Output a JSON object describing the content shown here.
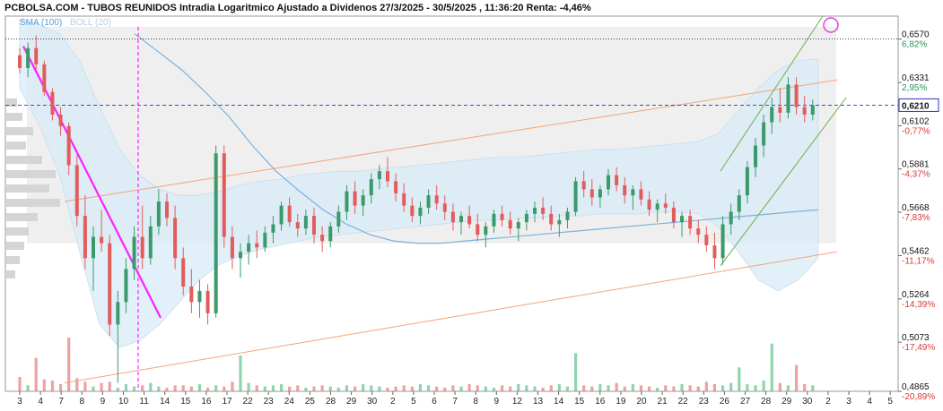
{
  "chart_data": {
    "type": "candlestick",
    "title": "PCBOLSA.COM - TUBOS REUNIDOS Intradia Logaritmico Ajustado a Dividenos 27/3/2025 - 30/5/2025 , 11:36:20 Renta: -4,46%",
    "legend": {
      "sma": "SMA (100)",
      "boll": "BOLL (20)"
    },
    "scale": "log",
    "ylim": [
      0.4865,
      0.67
    ],
    "price_ticks": [
      {
        "price": 0.657,
        "pct": "6,82%",
        "pos": true
      },
      {
        "price": 0.6331,
        "pct": "2,95%",
        "pos": true
      },
      {
        "price": 0.6102,
        "pct": "-0,77%",
        "pos": false
      },
      {
        "price": 0.5881,
        "pct": "-4,37%",
        "pos": false
      },
      {
        "price": 0.5668,
        "pct": "-7,83%",
        "pos": false
      },
      {
        "price": 0.5462,
        "pct": "-11,17%",
        "pos": false
      },
      {
        "price": 0.5264,
        "pct": "-14,39%",
        "pos": false
      },
      {
        "price": 0.5073,
        "pct": "-17,49%",
        "pos": false
      },
      {
        "price": 0.4865,
        "pct": "-20,89%",
        "pos": false
      }
    ],
    "price_tick_labels": [
      "0,6570",
      "0,6331",
      "0,6102",
      "0,5881",
      "0,5668",
      "0,5462",
      "0,5264",
      "0,5073",
      "0,4865"
    ],
    "current_price": {
      "value": 0.621,
      "label": "0,6210"
    },
    "reference_price": 0.657,
    "date_labels": [
      "3",
      "4",
      "7",
      "8",
      "9",
      "10",
      "11",
      "14",
      "15",
      "16",
      "17",
      "22",
      "23",
      "24",
      "25",
      "28",
      "29",
      "30",
      "2",
      "5",
      "6",
      "7",
      "8",
      "9",
      "12",
      "13",
      "14",
      "15",
      "16",
      "19",
      "20",
      "21",
      "22",
      "23",
      "26",
      "27",
      "28",
      "29",
      "30",
      "2",
      "3",
      "4",
      "5"
    ],
    "last_data_index": 38,
    "candles": [
      [
        0.648,
        0.652,
        0.638,
        0.641
      ],
      [
        0.641,
        0.655,
        0.636,
        0.652
      ],
      [
        0.652,
        0.659,
        0.64,
        0.643
      ],
      [
        0.643,
        0.645,
        0.626,
        0.628
      ],
      [
        0.628,
        0.63,
        0.613,
        0.616
      ],
      [
        0.616,
        0.62,
        0.605,
        0.61
      ],
      [
        0.61,
        0.612,
        0.585,
        0.59
      ],
      [
        0.59,
        0.595,
        0.56,
        0.565
      ],
      [
        0.565,
        0.575,
        0.54,
        0.545
      ],
      [
        0.545,
        0.56,
        0.53,
        0.555
      ],
      [
        0.555,
        0.568,
        0.548,
        0.552
      ],
      [
        0.552,
        0.556,
        0.51,
        0.515
      ],
      [
        0.515,
        0.53,
        0.49,
        0.525
      ],
      [
        0.525,
        0.545,
        0.52,
        0.54
      ],
      [
        0.54,
        0.56,
        0.535,
        0.555
      ],
      [
        0.555,
        0.57,
        0.54,
        0.545
      ],
      [
        0.545,
        0.565,
        0.542,
        0.56
      ],
      [
        0.56,
        0.578,
        0.556,
        0.572
      ],
      [
        0.572,
        0.576,
        0.56,
        0.564
      ],
      [
        0.564,
        0.57,
        0.54,
        0.545
      ],
      [
        0.545,
        0.55,
        0.528,
        0.532
      ],
      [
        0.532,
        0.54,
        0.52,
        0.525
      ],
      [
        0.525,
        0.535,
        0.518,
        0.53
      ],
      [
        0.53,
        0.533,
        0.515,
        0.52
      ],
      [
        0.52,
        0.6,
        0.518,
        0.596
      ],
      [
        0.596,
        0.6,
        0.55,
        0.555
      ],
      [
        0.555,
        0.56,
        0.54,
        0.545
      ],
      [
        0.545,
        0.552,
        0.536,
        0.548
      ],
      [
        0.548,
        0.556,
        0.542,
        0.552
      ],
      [
        0.552,
        0.558,
        0.545,
        0.55
      ],
      [
        0.55,
        0.56,
        0.548,
        0.557
      ],
      [
        0.557,
        0.565,
        0.552,
        0.561
      ],
      [
        0.561,
        0.572,
        0.558,
        0.57
      ],
      [
        0.57,
        0.574,
        0.56,
        0.562
      ],
      [
        0.562,
        0.566,
        0.555,
        0.559
      ],
      [
        0.559,
        0.568,
        0.556,
        0.565
      ],
      [
        0.565,
        0.569,
        0.552,
        0.556
      ],
      [
        0.556,
        0.56,
        0.548,
        0.553
      ],
      [
        0.553,
        0.562,
        0.55,
        0.56
      ],
      [
        0.56,
        0.57,
        0.557,
        0.567
      ],
      [
        0.567,
        0.58,
        0.563,
        0.577
      ],
      [
        0.577,
        0.582,
        0.566,
        0.57
      ],
      [
        0.57,
        0.578,
        0.565,
        0.575
      ],
      [
        0.575,
        0.586,
        0.571,
        0.583
      ],
      [
        0.583,
        0.59,
        0.578,
        0.587
      ],
      [
        0.587,
        0.594,
        0.579,
        0.582
      ],
      [
        0.582,
        0.586,
        0.572,
        0.576
      ],
      [
        0.576,
        0.581,
        0.567,
        0.57
      ],
      [
        0.57,
        0.574,
        0.562,
        0.565
      ],
      [
        0.565,
        0.572,
        0.561,
        0.569
      ],
      [
        0.569,
        0.578,
        0.566,
        0.575
      ],
      [
        0.575,
        0.58,
        0.568,
        0.571
      ],
      [
        0.571,
        0.575,
        0.563,
        0.567
      ],
      [
        0.567,
        0.571,
        0.558,
        0.562
      ],
      [
        0.562,
        0.567,
        0.556,
        0.565
      ],
      [
        0.565,
        0.57,
        0.559,
        0.561
      ],
      [
        0.561,
        0.566,
        0.553,
        0.556
      ],
      [
        0.556,
        0.562,
        0.55,
        0.56
      ],
      [
        0.56,
        0.568,
        0.557,
        0.566
      ],
      [
        0.566,
        0.57,
        0.56,
        0.563
      ],
      [
        0.563,
        0.567,
        0.556,
        0.559
      ],
      [
        0.559,
        0.564,
        0.553,
        0.562
      ],
      [
        0.562,
        0.568,
        0.558,
        0.566
      ],
      [
        0.566,
        0.572,
        0.562,
        0.569
      ],
      [
        0.569,
        0.574,
        0.563,
        0.566
      ],
      [
        0.566,
        0.57,
        0.558,
        0.561
      ],
      [
        0.561,
        0.566,
        0.555,
        0.563
      ],
      [
        0.563,
        0.569,
        0.559,
        0.567
      ],
      [
        0.567,
        0.584,
        0.565,
        0.582
      ],
      [
        0.582,
        0.587,
        0.574,
        0.578
      ],
      [
        0.578,
        0.583,
        0.57,
        0.574
      ],
      [
        0.574,
        0.58,
        0.569,
        0.578
      ],
      [
        0.578,
        0.588,
        0.575,
        0.585
      ],
      [
        0.585,
        0.589,
        0.577,
        0.58
      ],
      [
        0.58,
        0.584,
        0.571,
        0.575
      ],
      [
        0.575,
        0.58,
        0.568,
        0.578
      ],
      [
        0.578,
        0.582,
        0.57,
        0.573
      ],
      [
        0.573,
        0.577,
        0.565,
        0.568
      ],
      [
        0.568,
        0.573,
        0.562,
        0.571
      ],
      [
        0.571,
        0.576,
        0.566,
        0.569
      ],
      [
        0.569,
        0.572,
        0.559,
        0.562
      ],
      [
        0.562,
        0.567,
        0.555,
        0.565
      ],
      [
        0.565,
        0.568,
        0.556,
        0.559
      ],
      [
        0.559,
        0.563,
        0.552,
        0.556
      ],
      [
        0.556,
        0.56,
        0.548,
        0.551
      ],
      [
        0.551,
        0.557,
        0.54,
        0.545
      ],
      [
        0.545,
        0.565,
        0.542,
        0.561
      ],
      [
        0.561,
        0.571,
        0.556,
        0.567
      ],
      [
        0.567,
        0.578,
        0.563,
        0.575
      ],
      [
        0.575,
        0.592,
        0.571,
        0.589
      ],
      [
        0.589,
        0.604,
        0.584,
        0.6
      ],
      [
        0.6,
        0.616,
        0.594,
        0.612
      ],
      [
        0.612,
        0.625,
        0.606,
        0.62
      ],
      [
        0.62,
        0.63,
        0.612,
        0.617
      ],
      [
        0.617,
        0.636,
        0.614,
        0.632
      ],
      [
        0.632,
        0.636,
        0.616,
        0.62
      ],
      [
        0.62,
        0.626,
        0.612,
        0.616
      ],
      [
        0.616,
        0.624,
        0.613,
        0.621
      ]
    ],
    "volumes": [
      0.12,
      0.05,
      0.28,
      0.1,
      0.09,
      0.06,
      0.45,
      0.11,
      0.08,
      0.04,
      0.07,
      0.08,
      0.03,
      0.06,
      0.04,
      0.05,
      0.07,
      0.04,
      0.03,
      0.05,
      0.05,
      0.04,
      0.06,
      0.03,
      0.05,
      0.04,
      0.08,
      0.3,
      0.07,
      0.05,
      0.04,
      0.05,
      0.06,
      0.04,
      0.05,
      0.03,
      0.04,
      0.05,
      0.04,
      0.03,
      0.05,
      0.04,
      0.06,
      0.05,
      0.04,
      0.03,
      0.04,
      0.05,
      0.04,
      0.06,
      0.05,
      0.04,
      0.03,
      0.05,
      0.04,
      0.06,
      0.05,
      0.04,
      0.03,
      0.05,
      0.04,
      0.06,
      0.05,
      0.04,
      0.03,
      0.05,
      0.06,
      0.04,
      0.32,
      0.05,
      0.04,
      0.06,
      0.05,
      0.07,
      0.04,
      0.06,
      0.05,
      0.04,
      0.03,
      0.05,
      0.04,
      0.06,
      0.05,
      0.04,
      0.08,
      0.06,
      0.05,
      0.07,
      0.2,
      0.06,
      0.05,
      0.09,
      0.4,
      0.07,
      0.05,
      0.22,
      0.06,
      0.05
    ],
    "sma100": [
      0.66,
      0.65,
      0.64,
      0.628,
      0.615,
      0.6,
      0.587,
      0.577,
      0.568,
      0.561,
      0.556,
      0.553,
      0.552,
      0.552,
      0.553,
      0.554,
      0.555,
      0.556,
      0.557,
      0.558,
      0.559,
      0.56,
      0.561,
      0.562,
      0.563,
      0.564,
      0.565,
      0.566,
      0.567,
      0.568
    ],
    "boll_upper": [
      0.668,
      0.665,
      0.66,
      0.645,
      0.62,
      0.598,
      0.585,
      0.578,
      0.575,
      0.575,
      0.577,
      0.58,
      0.582,
      0.583,
      0.585,
      0.586,
      0.587,
      0.587,
      0.588,
      0.589,
      0.59,
      0.591,
      0.592,
      0.593,
      0.594,
      0.594,
      0.595,
      0.596,
      0.597,
      0.598,
      0.598,
      0.599,
      0.6,
      0.601,
      0.602,
      0.606,
      0.618,
      0.63,
      0.64,
      0.645,
      0.646
    ],
    "boll_lower": [
      0.63,
      0.61,
      0.585,
      0.548,
      0.515,
      0.505,
      0.508,
      0.515,
      0.525,
      0.535,
      0.542,
      0.546,
      0.549,
      0.551,
      0.553,
      0.555,
      0.556,
      0.557,
      0.558,
      0.559,
      0.56,
      0.561,
      0.562,
      0.563,
      0.563,
      0.564,
      0.564,
      0.565,
      0.565,
      0.566,
      0.566,
      0.566,
      0.567,
      0.567,
      0.566,
      0.56,
      0.548,
      0.535,
      0.53,
      0.535,
      0.545
    ],
    "channel": {
      "upper_start": [
        0.572,
        0
      ],
      "upper_end": [
        0.6345,
        1
      ],
      "lower_start": [
        0.49,
        0
      ],
      "lower_end": [
        0.548,
        1
      ]
    },
    "colors": {
      "up": "#3b9a6b",
      "down": "#e25c5c",
      "trend": "#ff20ff",
      "channel": "#f3a477",
      "green_channel": "#6ab04c",
      "sma": "#7ab3de",
      "boll_fill": "#d8ebf7",
      "ref_line": "#000000",
      "current_line": "#3030c0",
      "pos_pct": "#2f8f5a",
      "neg_pct": "#d93a3a"
    }
  }
}
